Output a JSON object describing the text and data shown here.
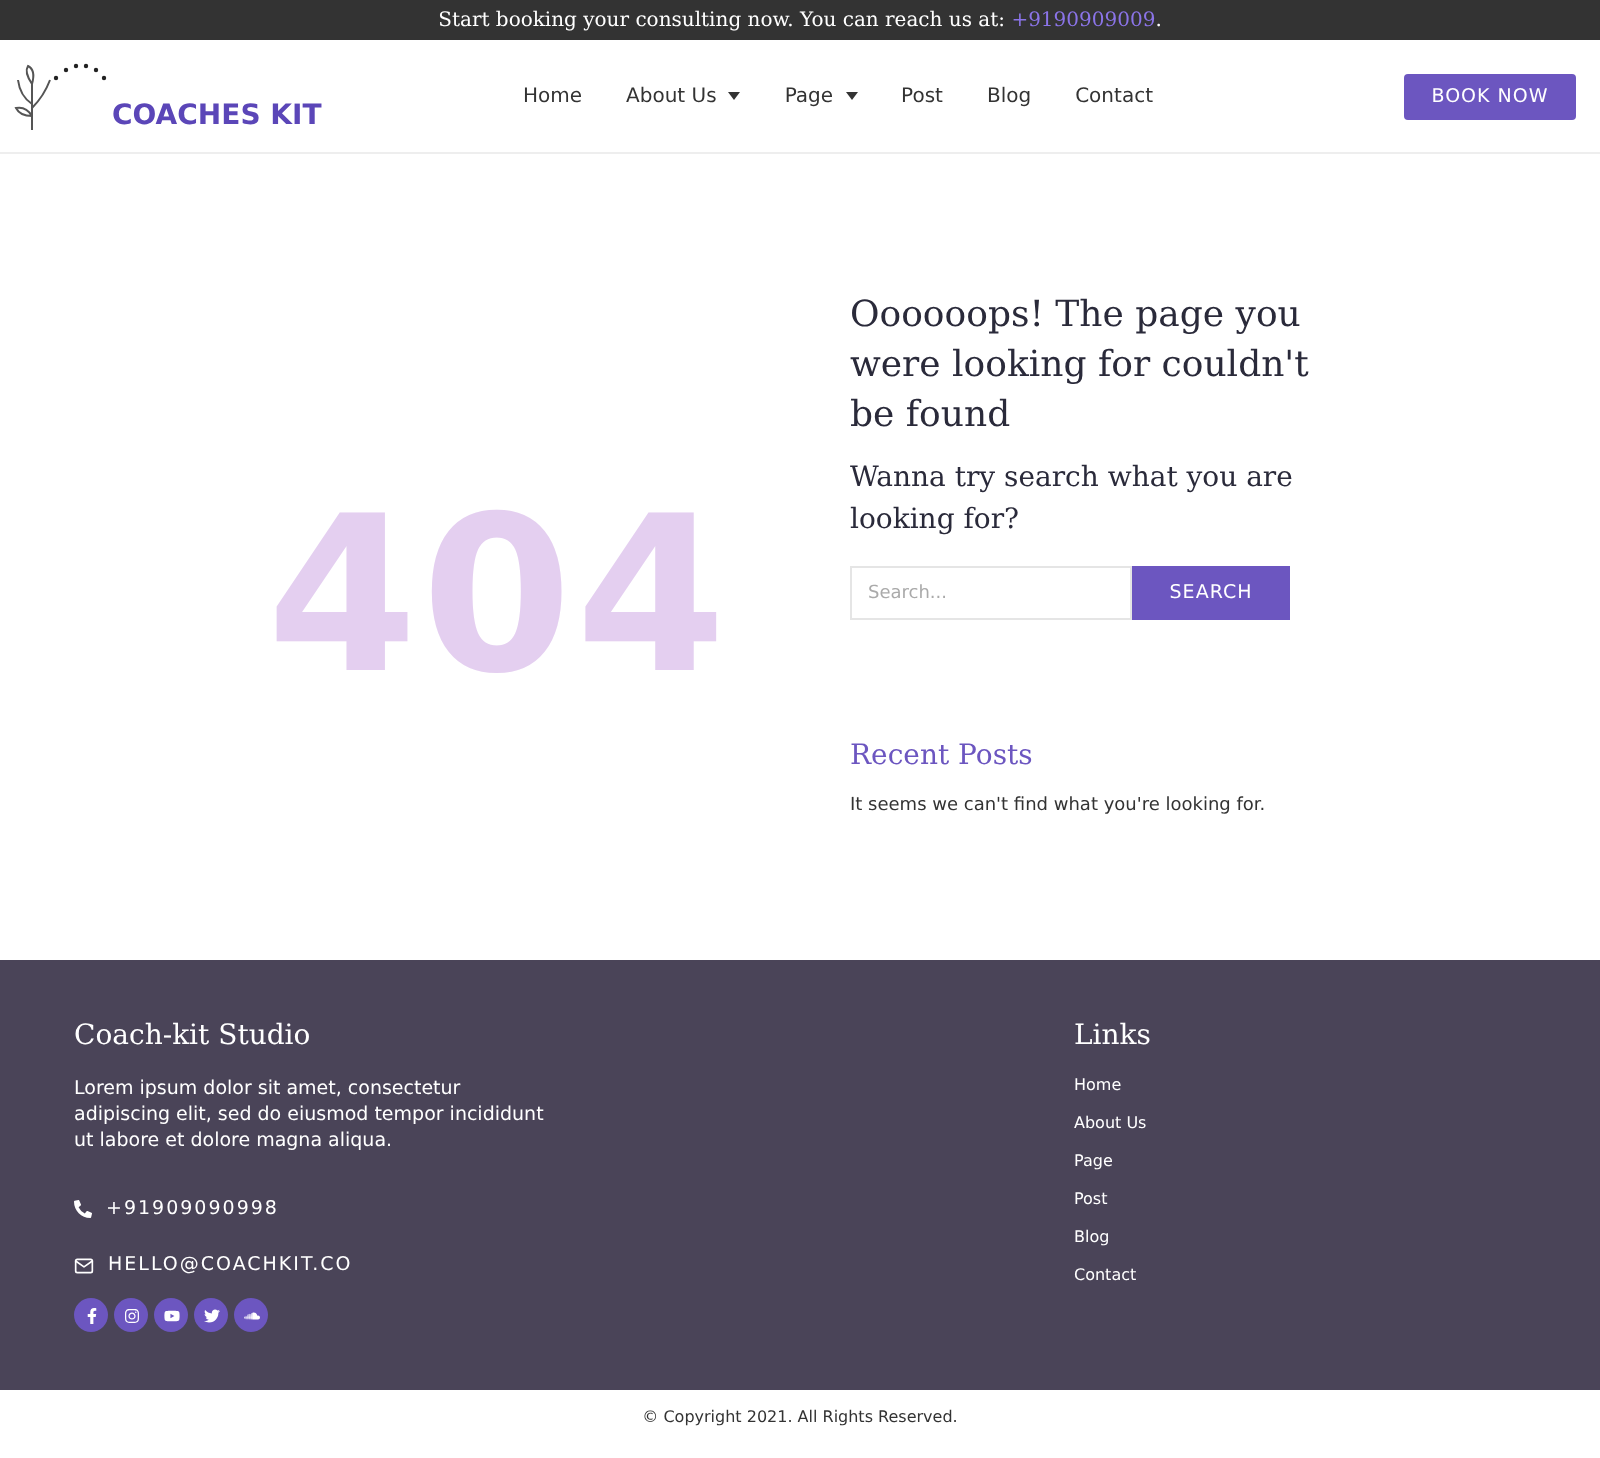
{
  "top_bar": {
    "text": "Start booking your consulting now. You can reach us at: ",
    "phone": "+9190909009",
    "suffix": "."
  },
  "header": {
    "logo": "COACHES KIT",
    "nav": [
      {
        "label": "Home",
        "dropdown": false
      },
      {
        "label": "About Us",
        "dropdown": true
      },
      {
        "label": "Page",
        "dropdown": true
      },
      {
        "label": "Post",
        "dropdown": false
      },
      {
        "label": "Blog",
        "dropdown": false
      },
      {
        "label": "Contact",
        "dropdown": false
      }
    ],
    "cta": "BOOK NOW"
  },
  "error": {
    "code": "404",
    "heading": "Oooooops! The page you were looking for couldn't be found",
    "subheading": "Wanna try search what you are looking for?",
    "search": {
      "placeholder": "Search...",
      "button": "SEARCH"
    },
    "recent_title": "Recent Posts",
    "recent_empty": "It seems we can't find what you're looking for."
  },
  "footer": {
    "title": "Coach-kit Studio",
    "description": "Lorem ipsum dolor sit amet, consectetur adipiscing elit, sed do eiusmod tempor incididunt ut labore et dolore magna aliqua.",
    "phone": "+91909090998",
    "email": "HELLO@COACHKIT.CO",
    "links_title": "Links",
    "links": [
      "Home",
      "About Us",
      "Page",
      "Post",
      "Blog",
      "Contact"
    ]
  },
  "copyright": "© Copyright 2021. All Rights Reserved."
}
